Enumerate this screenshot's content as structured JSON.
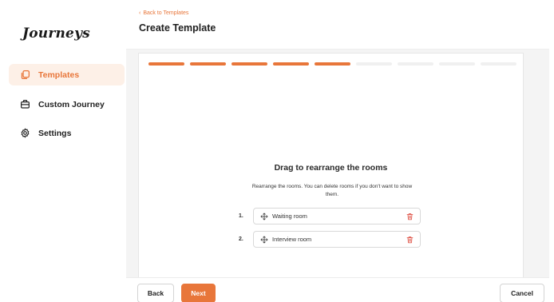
{
  "app": {
    "logo": "Journeys"
  },
  "sidebar": {
    "items": [
      {
        "label": "Templates",
        "icon": "copy-icon",
        "active": true
      },
      {
        "label": "Custom Journey",
        "icon": "briefcase-icon",
        "active": false
      },
      {
        "label": "Settings",
        "icon": "gear-icon",
        "active": false
      }
    ]
  },
  "header": {
    "back_link": "Back to Templates",
    "title": "Create Template"
  },
  "progress": {
    "completed_steps": 5,
    "total_steps": 9,
    "accent": "#e8763a"
  },
  "step": {
    "title": "Drag to rearrange the rooms",
    "description": "Rearrange the rooms. You can delete rooms if you don't want to show them.",
    "rooms": [
      {
        "number": "1.",
        "name": "Waiting room"
      },
      {
        "number": "2.",
        "name": "Interview room"
      }
    ]
  },
  "footer": {
    "back_label": "Back",
    "next_label": "Next",
    "cancel_label": "Cancel"
  },
  "colors": {
    "accent": "#e8763a",
    "active_bg": "#fdf0e7",
    "trash": "#e05a4f"
  }
}
